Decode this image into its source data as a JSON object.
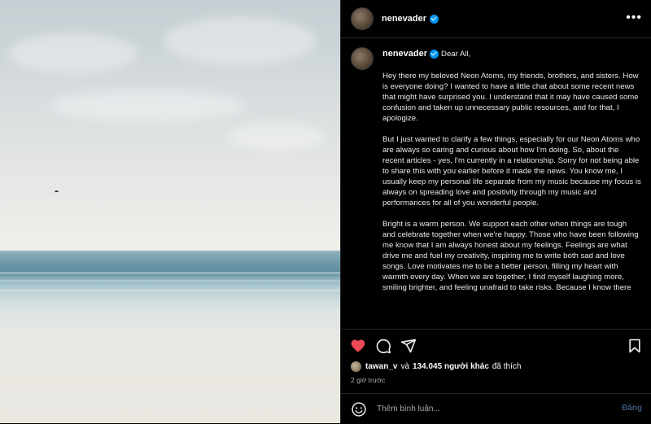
{
  "post": {
    "username": "nenevader",
    "verified": true,
    "more_icon": "more-horizontal-icon"
  },
  "caption": {
    "username": "nenevader",
    "greeting": "Dear All,",
    "paragraphs": [
      "Hey there my beloved Neon Atoms, my friends, brothers, and sisters. How is everyone doing? I wanted to have a little chat about some recent news that might have surprised you. I understand that it may have caused some confusion and taken up unnecessary public resources, and for that, I apologize.",
      "But I just wanted to clarify a few things, especially for our Neon Atoms who are always so caring and curious about how I'm doing. So, about the recent articles - yes, I'm currently in a relationship. Sorry for not being able to share this with you earlier before it made the news. You know me, I usually keep my personal life separate from my music because my focus is always on spreading love and positivity through my music and performances for all of you wonderful people.",
      "Bright is a warm person. We support each other when things are tough and celebrate together when we're happy. Those who have been following me know that I am always honest about my feelings. Feelings are what drive me and fuel my creativity, inspiring me to write both sad and love songs. Love motivates me to be a better person, filling my heart with warmth every day. When we are together, I find myself laughing more, smiling brighter, and feeling unafraid to take risks. Because I know there"
    ]
  },
  "likes": {
    "user": "tawan_v",
    "connector": "và",
    "others": "134.045 người khác",
    "suffix": "đã thích"
  },
  "time": "2 giờ trước",
  "comment": {
    "placeholder": "Thêm bình luận...",
    "post_label": "Đăng"
  },
  "colors": {
    "like": "#ed4956",
    "verified": "#0095f6",
    "background": "#000000"
  }
}
